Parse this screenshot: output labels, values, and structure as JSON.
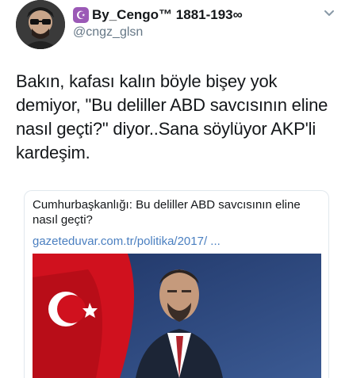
{
  "tweet": {
    "display_name": "By_Cengo™ 1881-193∞",
    "handle": "@cngz_glsn",
    "badge_glyph": "☪",
    "text": "Bakın, kafası kalın böyle bişey yok demiyor, \"Bu deliller ABD savcısının eline nasıl geçti?\" diyor..Sana söylüyor AKP'li kardeşim."
  },
  "card": {
    "title": "Cumhurbaşkanlığı: Bu deliller ABD savcısının eline nasıl geçti?",
    "url": "gazeteduvar.com.tr/politika/2017/ ..."
  },
  "colors": {
    "badge": "#9b59b6",
    "url": "#4a7fc0",
    "handle": "#657786"
  },
  "icons": {
    "avatar": "avatar-photo",
    "badge": "star-crescent-icon",
    "menu": "chevron-down-icon",
    "card_image": "news-photo"
  }
}
